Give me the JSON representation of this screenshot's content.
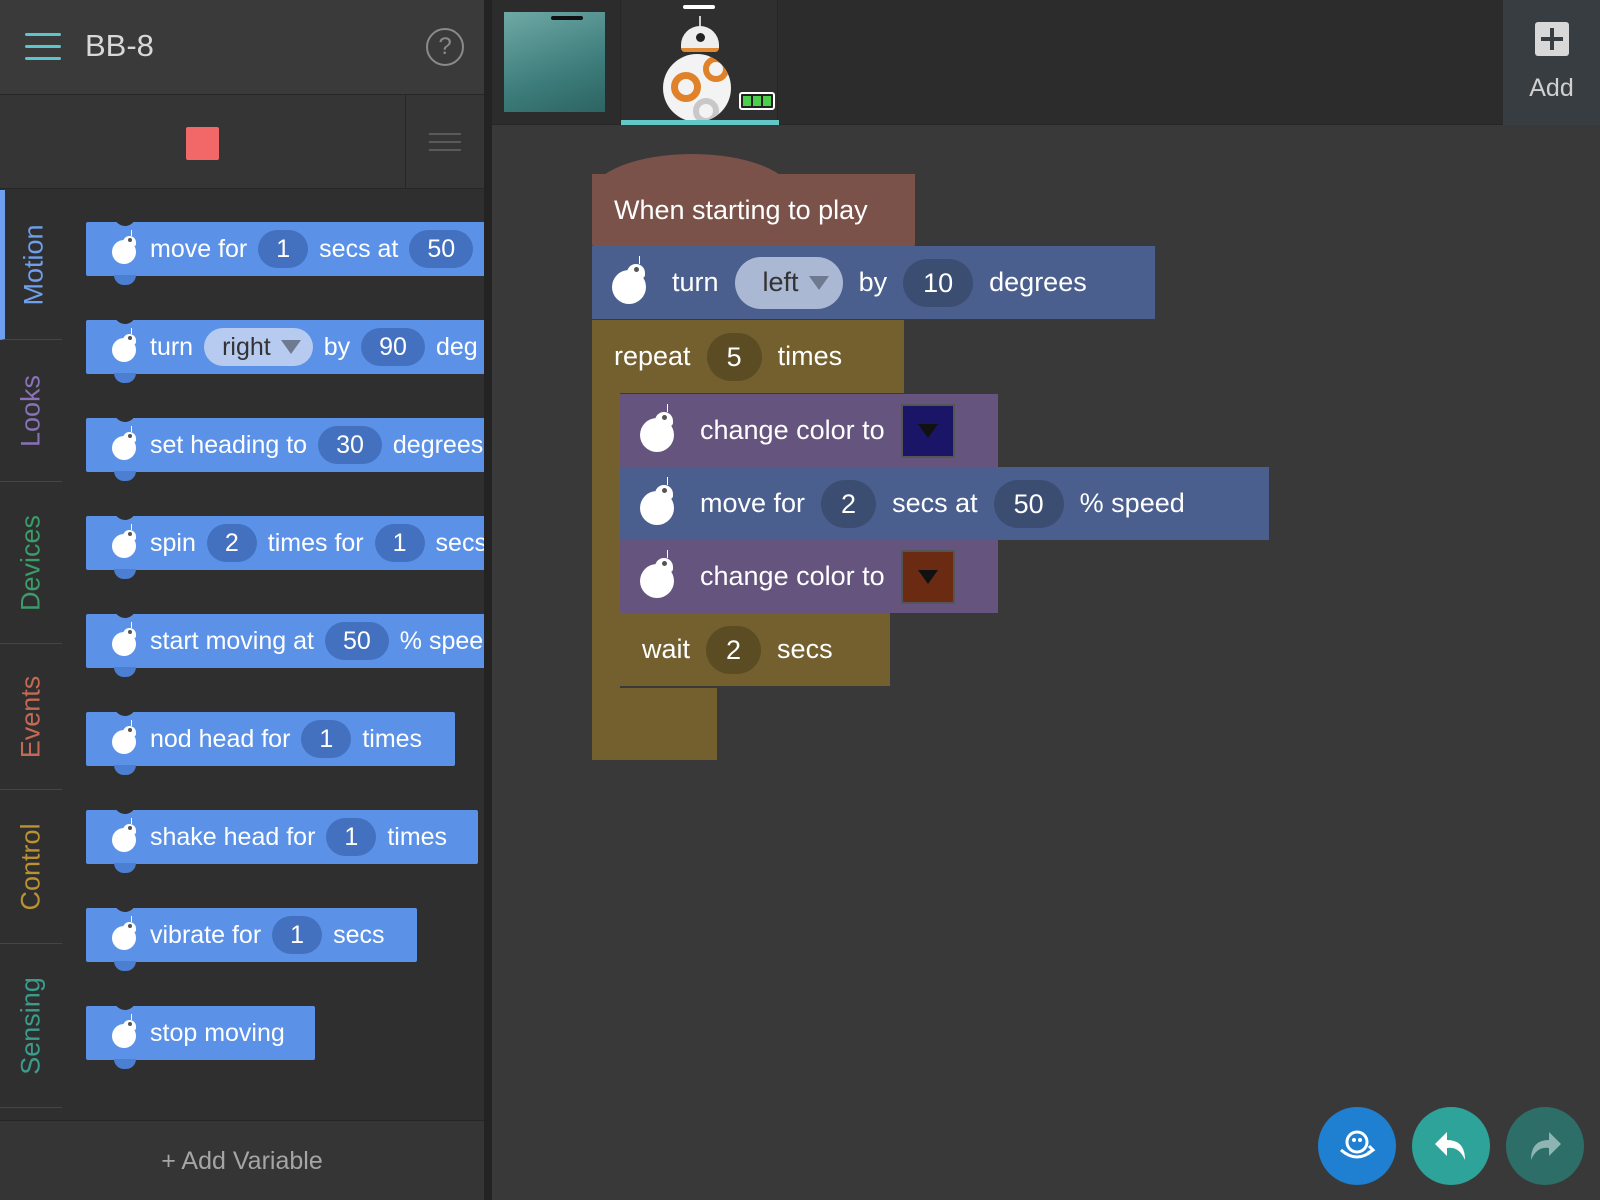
{
  "header": {
    "title": "BB-8"
  },
  "categories": [
    {
      "label": "Motion",
      "color": "#6ea0ef"
    },
    {
      "label": "Looks",
      "color": "#8a72b8"
    },
    {
      "label": "Devices",
      "color": "#3d9a6a"
    },
    {
      "label": "Events",
      "color": "#c26a55"
    },
    {
      "label": "Control",
      "color": "#b99231"
    },
    {
      "label": "Sensing",
      "color": "#3b9c8c"
    }
  ],
  "palette": {
    "move": {
      "t1": "move for",
      "v1": "1",
      "t2": "secs at",
      "v2": "50"
    },
    "turn": {
      "t1": "turn",
      "dir": "right",
      "t2": "by",
      "v1": "90",
      "t3": "deg"
    },
    "heading": {
      "t1": "set heading to",
      "v1": "30",
      "t2": "degrees"
    },
    "spin": {
      "t1": "spin",
      "v1": "2",
      "t2": "times for",
      "v2": "1",
      "t3": "secs"
    },
    "start": {
      "t1": "start moving at",
      "v1": "50",
      "t2": "% speed"
    },
    "nod": {
      "t1": "nod head for",
      "v1": "1",
      "t2": "times"
    },
    "shake": {
      "t1": "shake head for",
      "v1": "1",
      "t2": "times"
    },
    "vibrate": {
      "t1": "vibrate for",
      "v1": "1",
      "t2": "secs"
    },
    "stop": {
      "t1": "stop moving"
    }
  },
  "add_variable": "+ Add Variable",
  "add_label": "Add",
  "script": {
    "hat": "When starting to play",
    "turn": {
      "t1": "turn",
      "dir": "left",
      "t2": "by",
      "v1": "10",
      "t3": "degrees"
    },
    "repeat": {
      "t1": "repeat",
      "v1": "5",
      "t2": "times"
    },
    "color1": {
      "t1": "change color to",
      "color": "#1a1566"
    },
    "move": {
      "t1": "move for",
      "v1": "2",
      "t2": "secs at",
      "v2": "50",
      "t3": "% speed"
    },
    "color2": {
      "t1": "change color to",
      "color": "#6b2a12"
    },
    "wait": {
      "t1": "wait",
      "v1": "2",
      "t2": "secs"
    }
  },
  "colors": {
    "motion": "#5b92e8",
    "stop": "#f26868",
    "accent": "#5bc6cc"
  }
}
